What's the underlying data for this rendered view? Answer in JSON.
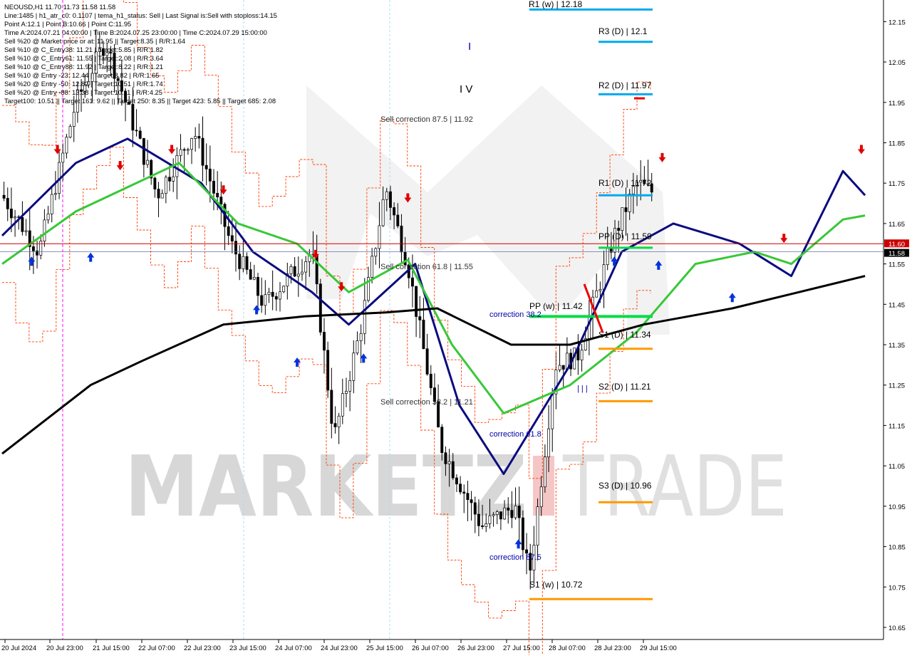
{
  "header": {
    "symbol_line": "NEOUSD,H1  11.70 11.73 11.58 11.58",
    "info_lines": [
      "Line:1485 | h1_atr_c0: 0.1107 | tema_h1_status: Sell | Last Signal is:Sell with stoploss:14.15",
      "Point A:12.1 | Point B:10.66 | Point C:11.95",
      "Time A:2024.07.21 04:00:00 | Time B:2024.07.25 23:00:00 | Time C:2024.07.29 15:00:00",
      "Sell %20 @ Market price or at: 11.95 || Target:8.35 | R/R:1.64",
      "Sell %10 @ C_Entry38: 11.21 | Target:5.85 | R/R:1.82",
      "Sell %10 @ C_Entry61: 11.55 | Target:2.08 | R/R:3.64",
      "Sell %10 @ C_Entry88: 11.92 | Target:8.22 | R/R:1.21",
      "Sell %10 @ Entry -23: 12.44 | Target:8.82 | R/R:1.65",
      "Sell %20 @ Entry -50: 12.82 | Target:10.51 | R/R:1.74",
      "Sell %20 @ Entry -88: 13.38 | Target:10.11 | R/R:4.25",
      "Target100: 10.51 || Target 161: 9.62 || Target 250: 8.35 || Target 423: 5.85 || Target 685: 2.08"
    ]
  },
  "watermark": {
    "left": "MARKETZ",
    "right": "TRADE",
    "bar_color": "#f2b8b8"
  },
  "colors": {
    "candle": "#000000",
    "bull_body": "#ffffff",
    "ma_navy": "#0b0b80",
    "ma_green": "#38c838",
    "ma_black": "#000000",
    "envelope": "#ff3b00",
    "price_red": "#cc0000",
    "bid_line": "#6b6bb0",
    "level_blue": "#00aaee",
    "level_orange": "#ff9900",
    "level_green": "#00dd44",
    "arrow_down": "#e00000",
    "arrow_up": "#0033dd"
  },
  "price_axis": {
    "ticks": [
      "12.15",
      "12.05",
      "11.95",
      "11.85",
      "11.75",
      "11.65",
      "11.55",
      "11.45",
      "11.35",
      "11.25",
      "11.15",
      "11.05",
      "10.95",
      "10.85",
      "10.75",
      "10.65"
    ],
    "current_red": "11.60",
    "current_blue": "11.58"
  },
  "time_axis": {
    "ticks": [
      "20 Jul 2024",
      "20 Jul 23:00",
      "21 Jul 15:00",
      "22 Jul 07:00",
      "22 Jul 23:00",
      "23 Jul 15:00",
      "24 Jul 07:00",
      "24 Jul 23:00",
      "25 Jul 15:00",
      "26 Jul 07:00",
      "26 Jul 23:00",
      "27 Jul 15:00",
      "28 Jul 07:00",
      "28 Jul 23:00",
      "29 Jul 15:00"
    ]
  },
  "levels": [
    {
      "label": "R1 (w) | 12.18",
      "color": "#00aaee"
    },
    {
      "label": "R3 (D) | 12.1",
      "color": "#00aaee"
    },
    {
      "label": "R2 (D) | 11.97",
      "color": "#00aaee"
    },
    {
      "label": "R1 (D) | 11.72",
      "color": "#00aaee"
    },
    {
      "label": "PP (D) | 11.59",
      "color": "#00dd44"
    },
    {
      "label": "PP (w) | 11.42",
      "color": "#00dd44"
    },
    {
      "label": "S1 (D) | 11.34",
      "color": "#ff9900"
    },
    {
      "label": "S2 (D) | 11.21",
      "color": "#ff9900"
    },
    {
      "label": "S3 (D) | 10.96",
      "color": "#ff9900"
    },
    {
      "label": "S1 (w) | 10.72",
      "color": "#ff9900"
    }
  ],
  "annotations": [
    {
      "text": "Sell correction 87.5 | 11.92",
      "color": "#333333"
    },
    {
      "text": "Sell correction 61.8 | 11.55",
      "color": "#333333"
    },
    {
      "text": "Sell correction 38.2 | 11.21",
      "color": "#333333"
    },
    {
      "text": "correction 38.2",
      "color": "#0000aa"
    },
    {
      "text": "correction 61.8",
      "color": "#0000aa"
    },
    {
      "text": "correction 87.5",
      "color": "#0000aa"
    },
    {
      "text": "I V",
      "color": "#000000"
    },
    {
      "text": "I",
      "color": "#0000aa"
    },
    {
      "text": "| | |",
      "color": "#0000aa"
    }
  ],
  "chart_data": {
    "type": "candlestick",
    "symbol": "NEOUSD",
    "timeframe": "H1",
    "last_bar": {
      "open": 11.7,
      "high": 11.73,
      "low": 11.58,
      "close": 11.58
    },
    "ylim": [
      10.62,
      12.2
    ],
    "xlim": [
      "2024-07-20 00:00",
      "2024-07-29 23:00"
    ],
    "key_points": [
      [
        "2024-07-20 00:00",
        11.72
      ],
      [
        "2024-07-20 10:00",
        11.58
      ],
      [
        "2024-07-20 20:00",
        11.95
      ],
      [
        "2024-07-21 04:00",
        12.1
      ],
      [
        "2024-07-21 18:00",
        11.72
      ],
      [
        "2024-07-22 04:00",
        11.88
      ],
      [
        "2024-07-22 14:00",
        11.6
      ],
      [
        "2024-07-22 23:00",
        11.45
      ],
      [
        "2024-07-23 12:00",
        11.58
      ],
      [
        "2024-07-23 18:00",
        11.12
      ],
      [
        "2024-07-24 01:00",
        11.38
      ],
      [
        "2024-07-24 08:00",
        11.74
      ],
      [
        "2024-07-24 14:00",
        11.55
      ],
      [
        "2024-07-24 23:00",
        11.1
      ],
      [
        "2024-07-25 10:00",
        10.9
      ],
      [
        "2024-07-25 19:00",
        10.95
      ],
      [
        "2024-07-25 23:00",
        10.78
      ],
      [
        "2024-07-26 06:00",
        11.3
      ],
      [
        "2024-07-26 12:00",
        11.32
      ],
      [
        "2024-07-26 22:00",
        11.62
      ],
      [
        "2024-07-27 04:00",
        11.75
      ],
      [
        "2024-07-27 14:00",
        11.7
      ],
      [
        "2024-07-27 22:00",
        11.68
      ],
      [
        "2024-07-28 07:00",
        11.55
      ],
      [
        "2024-07-28 14:00",
        11.6
      ],
      [
        "2024-07-28 21:00",
        11.42
      ],
      [
        "2024-07-29 04:00",
        11.75
      ],
      [
        "2024-07-29 10:00",
        11.95
      ],
      [
        "2024-07-29 15:00",
        11.7
      ],
      [
        "2024-07-29 18:00",
        11.58
      ]
    ],
    "moving_averages": [
      {
        "name": "navy",
        "color": "#0b0b80",
        "points": [
          [
            "2024-07-20 00:00",
            11.62
          ],
          [
            "2024-07-20 20:00",
            11.8
          ],
          [
            "2024-07-21 10:00",
            11.86
          ],
          [
            "2024-07-22 06:00",
            11.75
          ],
          [
            "2024-07-22 20:00",
            11.58
          ],
          [
            "2024-07-23 12:00",
            11.48
          ],
          [
            "2024-07-23 22:00",
            11.4
          ],
          [
            "2024-07-24 16:00",
            11.55
          ],
          [
            "2024-07-25 04:00",
            11.2
          ],
          [
            "2024-07-25 16:00",
            11.03
          ],
          [
            "2024-07-26 10:00",
            11.3
          ],
          [
            "2024-07-27 00:00",
            11.58
          ],
          [
            "2024-07-27 14:00",
            11.65
          ],
          [
            "2024-07-28 08:00",
            11.6
          ],
          [
            "2024-07-28 22:00",
            11.52
          ],
          [
            "2024-07-29 12:00",
            11.78
          ],
          [
            "2024-07-29 18:00",
            11.72
          ]
        ]
      },
      {
        "name": "green",
        "color": "#38c838",
        "points": [
          [
            "2024-07-20 00:00",
            11.55
          ],
          [
            "2024-07-20 20:00",
            11.68
          ],
          [
            "2024-07-21 10:00",
            11.74
          ],
          [
            "2024-07-22 00:00",
            11.8
          ],
          [
            "2024-07-22 16:00",
            11.65
          ],
          [
            "2024-07-23 08:00",
            11.6
          ],
          [
            "2024-07-23 22:00",
            11.48
          ],
          [
            "2024-07-24 14:00",
            11.56
          ],
          [
            "2024-07-25 02:00",
            11.35
          ],
          [
            "2024-07-25 16:00",
            11.18
          ],
          [
            "2024-07-26 10:00",
            11.25
          ],
          [
            "2024-07-27 04:00",
            11.38
          ],
          [
            "2024-07-27 20:00",
            11.55
          ],
          [
            "2024-07-28 12:00",
            11.58
          ],
          [
            "2024-07-28 22:00",
            11.55
          ],
          [
            "2024-07-29 12:00",
            11.66
          ],
          [
            "2024-07-29 18:00",
            11.67
          ]
        ]
      },
      {
        "name": "black",
        "color": "#000000",
        "points": [
          [
            "2024-07-20 00:00",
            11.08
          ],
          [
            "2024-07-21 00:00",
            11.25
          ],
          [
            "2024-07-21 14:00",
            11.31
          ],
          [
            "2024-07-22 12:00",
            11.4
          ],
          [
            "2024-07-23 10:00",
            11.42
          ],
          [
            "2024-07-24 08:00",
            11.43
          ],
          [
            "2024-07-24 22:00",
            11.44
          ],
          [
            "2024-07-25 18:00",
            11.35
          ],
          [
            "2024-07-26 10:00",
            11.35
          ],
          [
            "2024-07-27 06:00",
            11.4
          ],
          [
            "2024-07-28 06:00",
            11.44
          ],
          [
            "2024-07-29 00:00",
            11.48
          ],
          [
            "2024-07-29 18:00",
            11.52
          ]
        ]
      }
    ],
    "signals": {
      "sell": [
        [
          "2024-07-20 15:00",
          11.82
        ],
        [
          "2024-07-21 08:00",
          11.78
        ],
        [
          "2024-07-21 22:00",
          11.82
        ],
        [
          "2024-07-22 12:00",
          11.72
        ],
        [
          "2024-07-23 13:00",
          11.56
        ],
        [
          "2024-07-23 20:00",
          11.48
        ],
        [
          "2024-07-24 14:00",
          11.7
        ],
        [
          "2024-07-27 11:00",
          11.8
        ],
        [
          "2024-07-28 20:00",
          11.6
        ],
        [
          "2024-07-29 17:00",
          11.82
        ]
      ],
      "buy": [
        [
          "2024-07-20 08:00",
          11.57
        ],
        [
          "2024-07-21 00:00",
          11.58
        ],
        [
          "2024-07-22 21:00",
          11.45
        ],
        [
          "2024-07-23 08:00",
          11.32
        ],
        [
          "2024-07-24 02:00",
          11.33
        ],
        [
          "2024-07-25 20:00",
          10.87
        ],
        [
          "2024-07-26 22:00",
          11.57
        ],
        [
          "2024-07-27 10:00",
          11.56
        ],
        [
          "2024-07-28 06:00",
          11.48
        ]
      ]
    }
  }
}
